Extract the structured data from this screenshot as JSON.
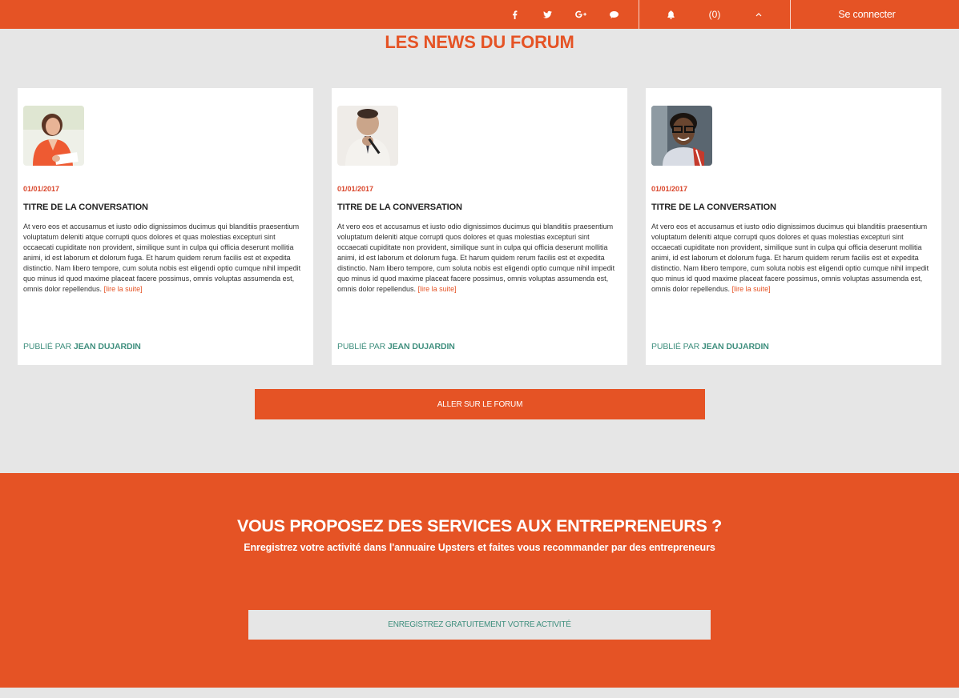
{
  "topbar": {
    "icons": [
      "facebook-icon",
      "twitter-icon",
      "google-plus-icon",
      "chat-icon",
      "bell-icon",
      "chevron-up-icon"
    ],
    "notification_count": "(0)",
    "login_label": "Se connecter"
  },
  "forum": {
    "title": "LES NEWS DU FORUM",
    "cards": [
      {
        "date": "01/01/2017",
        "title": "TITRE DE LA CONVERSATION",
        "excerpt": "At vero eos et accusamus et iusto odio dignissimos ducimus qui blanditiis praesentium voluptatum deleniti atque corrupti quos dolores et quas molestias excepturi sint occaecati cupiditate non provident, similique sunt in culpa qui officia deserunt mollitia animi, id est laborum et dolorum fuga. Et harum quidem rerum facilis est et expedita distinctio. Nam libero tempore, cum soluta nobis est eligendi optio cumque nihil impedit quo minus id quod maxime placeat facere possimus, omnis voluptas assumenda est, omnis dolor repellendus.",
        "read_more": "[lire la suite]",
        "author_prefix": "PUBLIÉ PAR",
        "author_name": "JEAN DUJARDIN"
      },
      {
        "date": "01/01/2017",
        "title": "TITRE DE LA CONVERSATION",
        "excerpt": "At vero eos et accusamus et iusto odio dignissimos ducimus qui blanditiis praesentium voluptatum deleniti atque corrupti quos dolores et quas molestias excepturi sint occaecati cupiditate non provident, similique sunt in culpa qui officia deserunt mollitia animi, id est laborum et dolorum fuga. Et harum quidem rerum facilis est et expedita distinctio. Nam libero tempore, cum soluta nobis est eligendi optio cumque nihil impedit quo minus id quod maxime placeat facere possimus, omnis voluptas assumenda est, omnis dolor repellendus.",
        "read_more": "[lire la suite]",
        "author_prefix": "PUBLIÉ PAR",
        "author_name": "JEAN DUJARDIN"
      },
      {
        "date": "01/01/2017",
        "title": "TITRE DE LA CONVERSATION",
        "excerpt": "At vero eos et accusamus et iusto odio dignissimos ducimus qui blanditiis praesentium voluptatum deleniti atque corrupti quos dolores et quas molestias excepturi sint occaecati cupiditate non provident, similique sunt in culpa qui officia deserunt mollitia animi, id est laborum et dolorum fuga. Et harum quidem rerum facilis est et expedita distinctio. Nam libero tempore, cum soluta nobis est eligendi optio cumque nihil impedit quo minus id quod maxime placeat facere possimus, omnis voluptas assumenda est, omnis dolor repellendus.",
        "read_more": "[lire la suite]",
        "author_prefix": "PUBLIÉ PAR",
        "author_name": "JEAN DUJARDIN"
      }
    ],
    "button_label": "ALLER SUR LE FORUM"
  },
  "cta": {
    "title": "VOUS PROPOSEZ DES SERVICES AUX ENTREPRENEURS ?",
    "subtitle": "Enregistrez votre activité dans l'annuaire Upsters et faites vous recommander par des entrepreneurs",
    "button_label": "ENREGISTREZ GRATUITEMENT VOTRE ACTIVITÉ"
  },
  "colors": {
    "accent": "#e55325",
    "background": "#e6e6e6",
    "author_green": "#3f8f7e",
    "date_red": "#d9452a"
  }
}
